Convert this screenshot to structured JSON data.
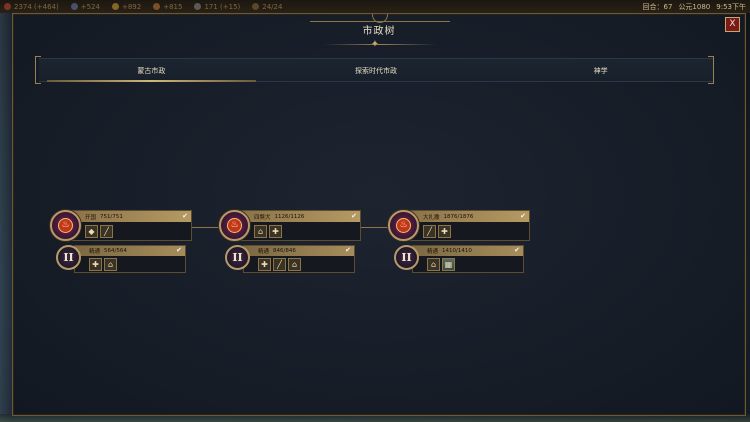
{
  "topbar": {
    "res_food": "2374 (+464)",
    "res_prod": "+524",
    "res_gold": "+892",
    "res_faith": "+815",
    "res_pop": "171 (+15)",
    "res_settle": "24/24",
    "turn": "回合：67",
    "year": "公元1080",
    "time": "9:53下午"
  },
  "window": {
    "title": "市政树",
    "close_label": "X"
  },
  "tabs": [
    {
      "label": "蒙古市政",
      "active": true
    },
    {
      "label": "探索时代市政",
      "active": false
    },
    {
      "label": "神学",
      "active": false
    }
  ],
  "nodes": [
    {
      "name": "开国",
      "progress": "751/751",
      "icons": [
        "◆",
        "╱"
      ],
      "mastery_name": "精通",
      "mastery_progress": "564/564",
      "mastery_icons": [
        "✚",
        "⌂"
      ]
    },
    {
      "name": "四獒犬",
      "progress": "1126/1126",
      "icons": [
        "⌂",
        "✚"
      ],
      "mastery_name": "精通",
      "mastery_progress": "846/846",
      "mastery_icons": [
        "✚",
        "╱",
        "⌂"
      ]
    },
    {
      "name": "大扎撒",
      "progress": "1876/1876",
      "icons": [
        "╱",
        "✚"
      ],
      "mastery_name": "精通",
      "mastery_progress": "1410/1410",
      "mastery_icons": [
        "⌂",
        "▦"
      ]
    }
  ],
  "symbols": {
    "check": "✔",
    "flame": "♨",
    "roman_two": "II",
    "star": "✦"
  }
}
